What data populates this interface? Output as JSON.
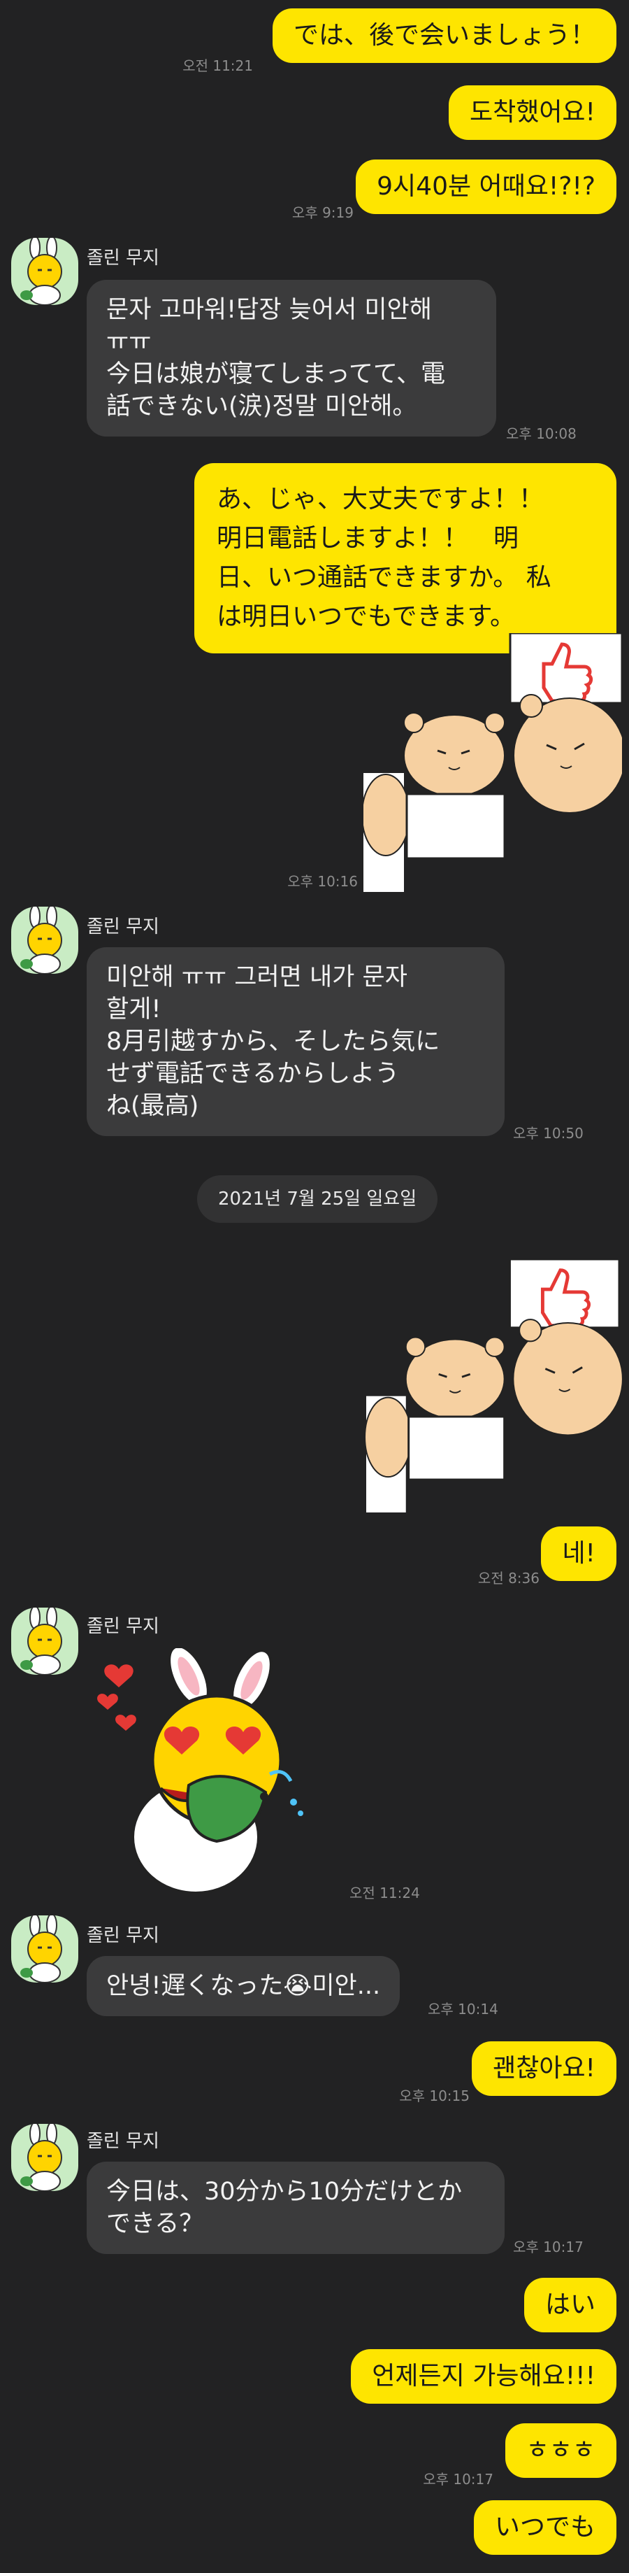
{
  "contact": {
    "name": "졸린 무지"
  },
  "date_divider": "2021년 7월 25일 일요일",
  "colors": {
    "background": "#222223",
    "my_bubble": "#fee500",
    "their_bubble": "#3b3b3c",
    "time_text": "#8d8d8d"
  },
  "messages": [
    {
      "id": "m1",
      "sender": "me",
      "text": "では、後で会いましょう！",
      "time": "오전 11:21"
    },
    {
      "id": "m2",
      "sender": "me",
      "text": "도착했어요!"
    },
    {
      "id": "m3",
      "sender": "me",
      "text": "9시40분 어때요!?!?",
      "time": "오후 9:19"
    },
    {
      "id": "m4",
      "sender": "them",
      "lines": [
        "문자 고마워!답장 늦어서 미안해",
        "ㅠㅠ",
        "今日は娘が寝てしまってて、電",
        "話できない(涙)정말 미안해。"
      ],
      "time": "오후 10:08"
    },
    {
      "id": "m5",
      "sender": "me",
      "lines": [
        "あ、じゃ、大丈夫ですよ！！",
        "明日電話しますよ！！　明",
        "日、いつ通話できますか。 私",
        "は明日いつでもできます。"
      ]
    },
    {
      "id": "m6",
      "sender": "me",
      "sticker": "bear-thumbs-up-sticker",
      "time": "오후 10:16"
    },
    {
      "id": "m7",
      "sender": "them",
      "lines": [
        "미안해 ㅠㅠ 그러면 내가 문자",
        "할게!",
        "8月引越すから、そしたら気に",
        "せず電話できるからしよう",
        "ね(最高)"
      ],
      "time": "오후 10:50"
    },
    {
      "id": "m8",
      "sender": "me",
      "sticker": "bear-thumbs-up-sticker"
    },
    {
      "id": "m9",
      "sender": "me",
      "text": "네!",
      "time": "오전 8:36"
    },
    {
      "id": "m10",
      "sender": "them",
      "sticker": "muji-hearts-sticker",
      "time": "오전 11:24"
    },
    {
      "id": "m11",
      "sender": "them",
      "text": "안녕!遅くなった😭미안...",
      "time": "오후 10:14"
    },
    {
      "id": "m12",
      "sender": "me",
      "text": "괜찮아요!",
      "time": "오후 10:15"
    },
    {
      "id": "m13",
      "sender": "them",
      "lines": [
        "今日は、30分から10分だけとか",
        "できる？"
      ],
      "time": "오후 10:17"
    },
    {
      "id": "m14",
      "sender": "me",
      "text": "はい"
    },
    {
      "id": "m15",
      "sender": "me",
      "text": "언제든지 가능해요!!!"
    },
    {
      "id": "m16",
      "sender": "me",
      "text": "ㅎㅎㅎ",
      "time": "오후 10:17"
    },
    {
      "id": "m17",
      "sender": "me",
      "text": "いつでも"
    }
  ]
}
